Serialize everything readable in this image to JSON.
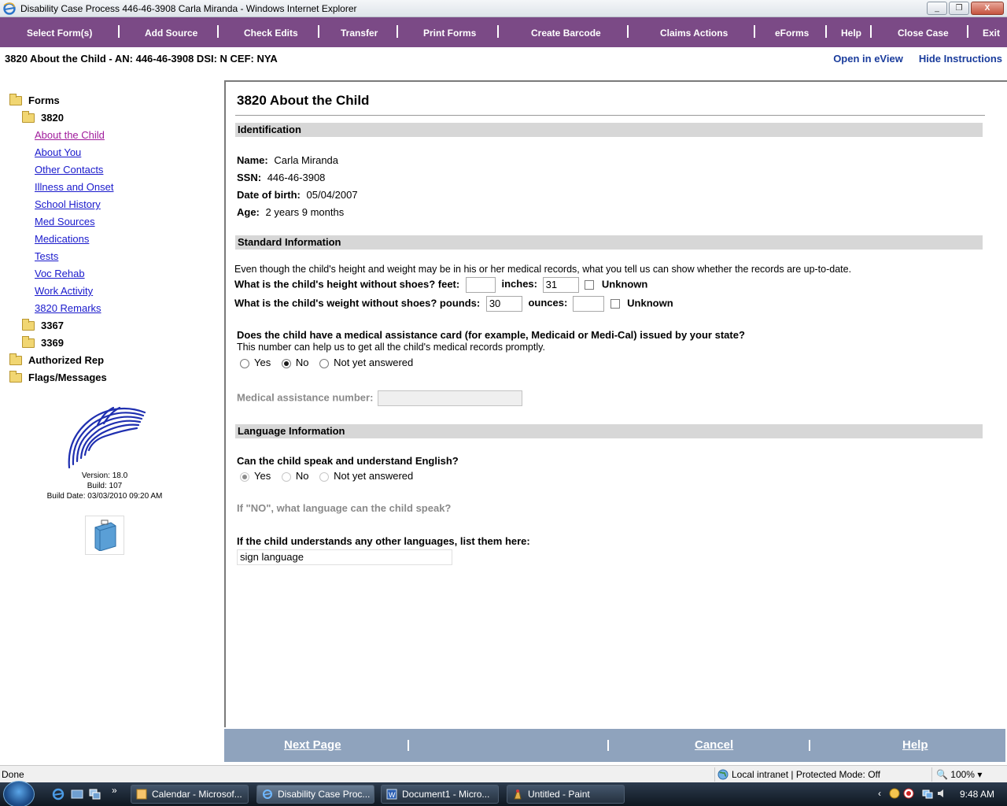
{
  "window": {
    "title": "Disability Case Process 446-46-3908 Carla Miranda - Windows Internet Explorer",
    "minimize_glyph": "_",
    "maximize_glyph": "❐",
    "close_glyph": "X"
  },
  "menu": {
    "items": [
      "Select Form(s)",
      "Add Source",
      "Check Edits",
      "Transfer",
      "Print Forms",
      "Create Barcode",
      "Claims Actions",
      "eForms",
      "Help",
      "Close Case",
      "Exit"
    ]
  },
  "header": {
    "case_info": "3820 About the Child - AN: 446-46-3908 DSI: N   CEF: NYA",
    "open_eview": "Open in eView",
    "hide_instructions": "Hide Instructions"
  },
  "sidebar": {
    "forms_label": "Forms",
    "form_3820": "3820",
    "links": [
      "About the Child",
      "About You",
      "Other Contacts",
      "Illness and Onset",
      "School History",
      "Med Sources",
      "Medications",
      "Tests",
      "Voc Rehab",
      "Work Activity",
      "3820 Remarks"
    ],
    "form_3367": "3367",
    "form_3369": "3369",
    "authorized_rep": "Authorized Rep",
    "flags_messages": "Flags/Messages",
    "version": "Version: 18.0",
    "build": "Build: 107",
    "build_date": "Build Date: 03/03/2010 09:20 AM"
  },
  "form": {
    "title": "3820 About the Child",
    "identification": {
      "heading": "Identification",
      "name_label": "Name:",
      "name_value": "Carla Miranda",
      "ssn_label": "SSN:",
      "ssn_value": "446-46-3908",
      "dob_label": "Date of birth:",
      "dob_value": "05/04/2007",
      "age_label": "Age:",
      "age_value": "2 years 9 months"
    },
    "standard": {
      "heading": "Standard Information",
      "intro": "Even though the child's height and weight may be in his or her medical records, what you tell us can show whether the records are up-to-date.",
      "height_label": "What is the child's height without shoes? feet:",
      "height_feet": "",
      "inches_label": "inches:",
      "height_inches": "31",
      "unknown_label": "Unknown",
      "weight_label": "What is the child's weight without shoes? pounds:",
      "weight_pounds": "30",
      "ounces_label": "ounces:",
      "weight_ounces": "",
      "medical_card_question": "Does the child have a medical assistance card (for example, Medicaid or Medi-Cal) issued by your state?",
      "medical_card_help": "This number can help us to get all the child's medical records promptly.",
      "radio_yes": "Yes",
      "radio_no": "No",
      "radio_not_answered": "Not yet answered",
      "medical_card_selected": "No",
      "medical_number_label": "Medical assistance number:",
      "medical_number_value": ""
    },
    "language": {
      "heading": "Language Information",
      "english_question": "Can the child speak and understand English?",
      "english_selected": "Yes",
      "if_no_question": "If \"NO\", what language can the child speak?",
      "other_languages_question": "If the child understands any other languages, list them here:",
      "other_languages_value": "sign language"
    }
  },
  "bottom_nav": {
    "next_page": "Next Page",
    "cancel": "Cancel",
    "help": "Help"
  },
  "status": {
    "left": "Done",
    "zone": "Local intranet | Protected Mode: Off",
    "zoom": "100%"
  },
  "taskbar": {
    "tasks": [
      "Calendar - Microsof...",
      "Disability Case Proc...",
      "Document1 - Micro...",
      "Untitled - Paint"
    ],
    "clock": "9:48 AM"
  },
  "colors": {
    "menubar": "#7b4a86",
    "bottombar": "#8fa3bd",
    "section": "#d7d7d7",
    "link": "#1a1acc",
    "active_link": "#a01c9c"
  }
}
